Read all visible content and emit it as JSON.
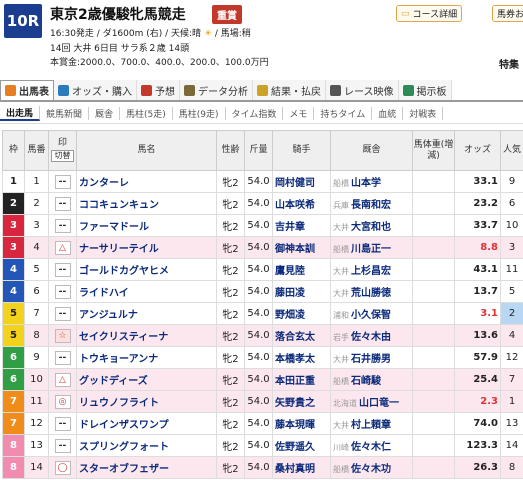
{
  "race": {
    "num": "10R",
    "name": "東京2歳優駿牝馬競走",
    "grade": "重賞",
    "line1": "16:30発走 / ダ1600m (右) / 天候:晴",
    "weather_icon": "sun-icon",
    "line1b": "/ 馬場:稍",
    "line2": "14回 大井 6日目 サラ系２歳 14頭",
    "line3": "本賞金:2000.0、700.0、400.0、200.0、100.0万円",
    "course_btn": "コース詳細",
    "horse_btn": "馬券お",
    "tokusen": "特集"
  },
  "tabs": [
    {
      "label": "出馬表",
      "icon": "list-icon",
      "color": "#e67e22"
    },
    {
      "label": "オッズ・購入",
      "icon": "odds-icon",
      "color": "#2c7bbf"
    },
    {
      "label": "予想",
      "icon": "target-icon",
      "color": "#c0392b"
    },
    {
      "label": "データ分析",
      "icon": "chart-icon",
      "color": "#7a6a3a"
    },
    {
      "label": "結果・払戻",
      "icon": "coin-icon",
      "color": "#c9a227"
    },
    {
      "label": "レース映像",
      "icon": "video-icon",
      "color": "#555555"
    },
    {
      "label": "掲示板",
      "icon": "board-icon",
      "color": "#2e8b57"
    }
  ],
  "subtabs": [
    "出走馬",
    "競馬新聞",
    "厩舎",
    "馬柱(5走)",
    "馬柱(9走)",
    "タイム指数",
    "メモ",
    "持ちタイム",
    "血統",
    "対戦表"
  ],
  "columns": {
    "frame": "枠",
    "num": "馬番",
    "mark": "印",
    "mark_btn": "切替",
    "name": "馬名",
    "sexage": "性齢",
    "weight": "斤量",
    "jockey": "騎手",
    "trainer": "厩舎",
    "bodyweight": "馬体重(増減)",
    "odds": "オッズ",
    "pop": "人気"
  },
  "entries": [
    {
      "frame": "1",
      "num": "1",
      "mark": "--",
      "name": "カンターレ",
      "sa": "牝2",
      "wt": "54.0",
      "jockey": "岡村健司",
      "area": "船橋",
      "trainer": "山本学",
      "odds": "33.1",
      "pop": "9",
      "oddsred": false
    },
    {
      "frame": "2",
      "num": "2",
      "mark": "--",
      "name": "ココキュンキュン",
      "sa": "牝2",
      "wt": "54.0",
      "jockey": "山本咲希",
      "area": "兵庫",
      "trainer": "長南和宏",
      "odds": "23.2",
      "pop": "6",
      "oddsred": false
    },
    {
      "frame": "3",
      "num": "3",
      "mark": "--",
      "name": "ファーマドール",
      "sa": "牝2",
      "wt": "54.0",
      "jockey": "吉井章",
      "area": "大井",
      "trainer": "大宮和也",
      "odds": "33.7",
      "pop": "10",
      "oddsred": false
    },
    {
      "frame": "3",
      "num": "4",
      "mark": "△",
      "name": "ナーサリーテイル",
      "sa": "牝2",
      "wt": "54.0",
      "jockey": "御神本訓",
      "area": "船橋",
      "trainer": "川島正一",
      "odds": "8.8",
      "pop": "3",
      "oddsred": true
    },
    {
      "frame": "4",
      "num": "5",
      "mark": "--",
      "name": "ゴールドカグヤヒメ",
      "sa": "牝2",
      "wt": "54.0",
      "jockey": "鷹見陸",
      "area": "大井",
      "trainer": "上杉昌宏",
      "odds": "43.1",
      "pop": "11",
      "oddsred": false
    },
    {
      "frame": "4",
      "num": "6",
      "mark": "--",
      "name": "ライドハイ",
      "sa": "牝2",
      "wt": "54.0",
      "jockey": "藤田凌",
      "area": "大井",
      "trainer": "荒山勝徳",
      "odds": "13.7",
      "pop": "5",
      "oddsred": false
    },
    {
      "frame": "5",
      "num": "7",
      "mark": "--",
      "name": "アンジュルナ",
      "sa": "牝2",
      "wt": "54.0",
      "jockey": "野畑凌",
      "area": "浦和",
      "trainer": "小久保智",
      "odds": "3.1",
      "pop": "2",
      "oddsred": true
    },
    {
      "frame": "5",
      "num": "8",
      "mark": "☆",
      "name": "セイクリスティーナ",
      "sa": "牝2",
      "wt": "54.0",
      "jockey": "落合玄太",
      "area": "岩手",
      "trainer": "佐々木由",
      "odds": "13.6",
      "pop": "4",
      "oddsred": false
    },
    {
      "frame": "6",
      "num": "9",
      "mark": "--",
      "name": "トウキョーアンナ",
      "sa": "牝2",
      "wt": "54.0",
      "jockey": "本橋孝太",
      "area": "大井",
      "trainer": "石井勝男",
      "odds": "57.9",
      "pop": "12",
      "oddsred": false
    },
    {
      "frame": "6",
      "num": "10",
      "mark": "△",
      "name": "グッドディーズ",
      "sa": "牝2",
      "wt": "54.0",
      "jockey": "本田正重",
      "area": "船橋",
      "trainer": "石崎駿",
      "odds": "25.4",
      "pop": "7",
      "oddsred": false
    },
    {
      "frame": "7",
      "num": "11",
      "mark": "◎",
      "name": "リュウノフライト",
      "sa": "牝2",
      "wt": "54.0",
      "jockey": "矢野貴之",
      "area": "北海道",
      "trainer": "山口竜一",
      "odds": "2.3",
      "pop": "1",
      "oddsred": true
    },
    {
      "frame": "7",
      "num": "12",
      "mark": "--",
      "name": "ドレインザスワンプ",
      "sa": "牝2",
      "wt": "54.0",
      "jockey": "藤本現暉",
      "area": "大井",
      "trainer": "村上頼章",
      "odds": "74.0",
      "pop": "13",
      "oddsred": false
    },
    {
      "frame": "8",
      "num": "13",
      "mark": "--",
      "name": "スプリングフォート",
      "sa": "牝2",
      "wt": "54.0",
      "jockey": "佐野遥久",
      "area": "川崎",
      "trainer": "佐々木仁",
      "odds": "123.3",
      "pop": "14",
      "oddsred": false
    },
    {
      "frame": "8",
      "num": "14",
      "mark": "◯",
      "name": "スターオブフェザー",
      "sa": "牝2",
      "wt": "54.0",
      "jockey": "桑村真明",
      "area": "船橋",
      "trainer": "佐々木功",
      "odds": "26.3",
      "pop": "8",
      "oddsred": false
    }
  ],
  "frame_colors": {
    "1": [
      "#ffffff",
      "#222222"
    ],
    "2": [
      "#222222",
      "#ffffff"
    ],
    "3": [
      "#d7263d",
      "#ffffff"
    ],
    "4": [
      "#2456b8",
      "#ffffff"
    ],
    "5": [
      "#f2d21b",
      "#222222"
    ],
    "6": [
      "#2f9e44",
      "#ffffff"
    ],
    "7": [
      "#f08c1a",
      "#ffffff"
    ],
    "8": [
      "#f28bb0",
      "#ffffff"
    ]
  }
}
